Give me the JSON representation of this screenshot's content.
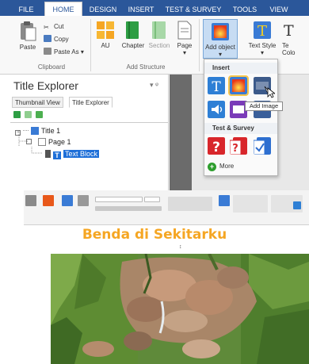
{
  "ribbon_tabs": [
    "FILE",
    "HOME",
    "DESIGN",
    "INSERT",
    "TEST & SURVEY",
    "TOOLS",
    "VIEW"
  ],
  "clipboard": {
    "paste": "Paste",
    "cut": "Cut",
    "copy": "Copy",
    "paste_as": "Paste As",
    "paste_as_arrow": "▾",
    "group": "Clipboard"
  },
  "add_structure": {
    "au": "AU",
    "chapter": "Chapter",
    "section": "Section",
    "page": "Page",
    "page_arrow": "▾",
    "group": "Add Structure"
  },
  "add_object": {
    "label": "Add object",
    "arrow": "▾"
  },
  "text_style": {
    "label": "Text Style",
    "arrow": "▾"
  },
  "text_color_partial": {
    "line1": "Te",
    "line2": "Colo"
  },
  "explorer": {
    "title": "Title Explorer",
    "pin": "▾ ᵠ",
    "tabs": [
      "Thumbnail View",
      "Title Explorer"
    ],
    "tree": {
      "title": "Title 1",
      "page": "Page 1",
      "block": "Text Block"
    }
  },
  "dropdown": {
    "insert_header": "Insert",
    "test_header": "Test & Survey",
    "tooltip": "Add Image",
    "more": "More",
    "more_symbol": "+"
  },
  "document": {
    "title": "Benda di Sekitarku"
  },
  "colors": {
    "tab_bar": "#2b579a",
    "selection": "#1e6fd8",
    "title_orange": "#f5a623"
  }
}
